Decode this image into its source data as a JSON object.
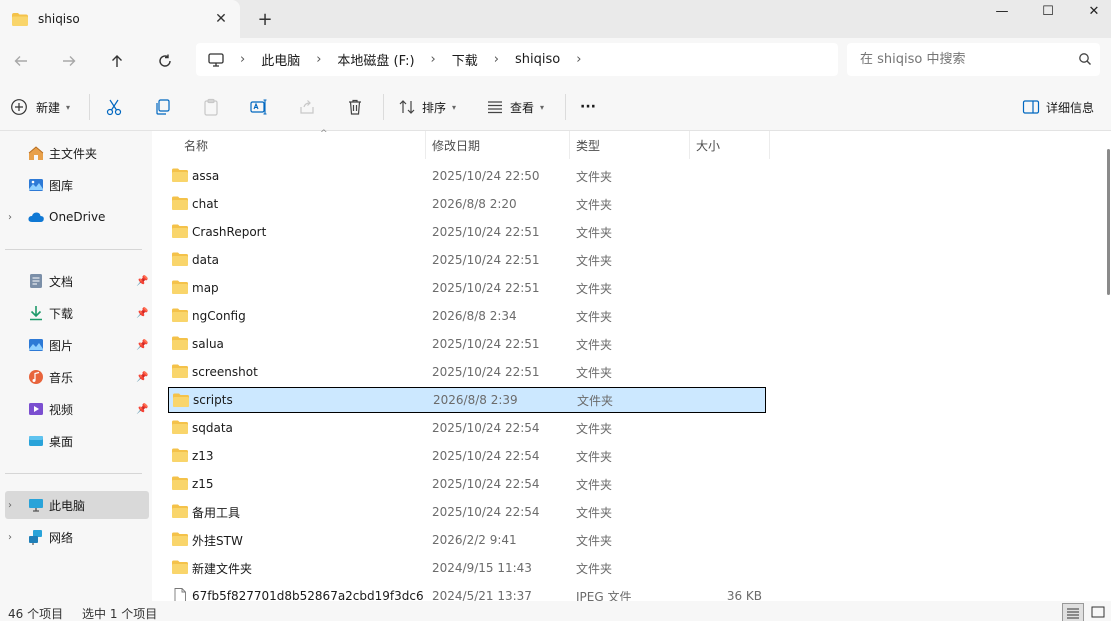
{
  "tab": {
    "title": "shiqiso",
    "close_glyph": "✕",
    "new_glyph": "+"
  },
  "window": {
    "minimize": "—",
    "maximize": "☐",
    "close": "✕"
  },
  "nav": {
    "breadcrumbs": [
      "此电脑",
      "本地磁盘 (F:)",
      "下载",
      "shiqiso"
    ],
    "search_placeholder": "在 shiqiso 中搜索"
  },
  "toolbar": {
    "new_label": "新建",
    "sort_label": "排序",
    "view_label": "查看",
    "more_label": "···",
    "details_label": "详细信息"
  },
  "sidebar": {
    "items": [
      {
        "label": "主文件夹",
        "icon": "home-icon"
      },
      {
        "label": "图库",
        "icon": "gallery-icon"
      },
      {
        "label": "OneDrive",
        "icon": "cloud-icon"
      },
      {
        "label": "文档",
        "icon": "document-icon"
      },
      {
        "label": "下载",
        "icon": "download-icon"
      },
      {
        "label": "图片",
        "icon": "pictures-icon"
      },
      {
        "label": "音乐",
        "icon": "music-icon"
      },
      {
        "label": "视频",
        "icon": "video-icon"
      },
      {
        "label": "桌面",
        "icon": "desktop-icon"
      },
      {
        "label": "此电脑",
        "icon": "computer-icon"
      },
      {
        "label": "网络",
        "icon": "network-icon"
      }
    ]
  },
  "columns": {
    "name": "名称",
    "date": "修改日期",
    "type": "类型",
    "size": "大小"
  },
  "files": [
    {
      "name": "assa",
      "date": "2025/10/24 22:50",
      "type": "文件夹",
      "size": ""
    },
    {
      "name": "chat",
      "date": "2026/8/8 2:20",
      "type": "文件夹",
      "size": ""
    },
    {
      "name": "CrashReport",
      "date": "2025/10/24 22:51",
      "type": "文件夹",
      "size": ""
    },
    {
      "name": "data",
      "date": "2025/10/24 22:51",
      "type": "文件夹",
      "size": ""
    },
    {
      "name": "map",
      "date": "2025/10/24 22:51",
      "type": "文件夹",
      "size": ""
    },
    {
      "name": "ngConfig",
      "date": "2026/8/8 2:34",
      "type": "文件夹",
      "size": ""
    },
    {
      "name": "salua",
      "date": "2025/10/24 22:51",
      "type": "文件夹",
      "size": ""
    },
    {
      "name": "screenshot",
      "date": "2025/10/24 22:51",
      "type": "文件夹",
      "size": ""
    },
    {
      "name": "scripts",
      "date": "2026/8/8 2:39",
      "type": "文件夹",
      "size": ""
    },
    {
      "name": "sqdata",
      "date": "2025/10/24 22:54",
      "type": "文件夹",
      "size": ""
    },
    {
      "name": "z13",
      "date": "2025/10/24 22:54",
      "type": "文件夹",
      "size": ""
    },
    {
      "name": "z15",
      "date": "2025/10/24 22:54",
      "type": "文件夹",
      "size": ""
    },
    {
      "name": "备用工具",
      "date": "2025/10/24 22:54",
      "type": "文件夹",
      "size": ""
    },
    {
      "name": "外挂STW",
      "date": "2026/2/2 9:41",
      "type": "文件夹",
      "size": ""
    },
    {
      "name": "新建文件夹",
      "date": "2024/9/15 11:43",
      "type": "文件夹",
      "size": ""
    },
    {
      "name": "67fb5f827701d8b52867a2cbd19f3dc6",
      "date": "2024/5/21 13:37",
      "type": "JPEG 文件",
      "size": "36 KB"
    }
  ],
  "status": {
    "count": "46 个项目",
    "selection": "选中 1 个项目"
  },
  "colors": {
    "folder": "#f4c24a",
    "selection": "#cce8ff",
    "accent": "#0067c0"
  }
}
